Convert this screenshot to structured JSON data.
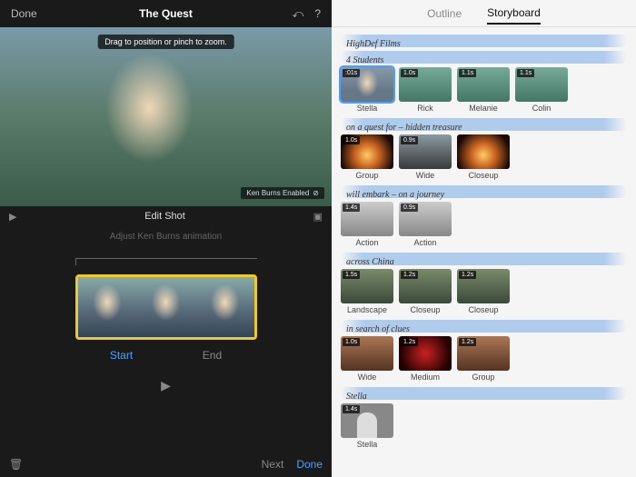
{
  "header": {
    "done": "Done",
    "title": "The Quest"
  },
  "preview": {
    "tip": "Drag to position or pinch to zoom.",
    "kb_badge": "Ken Burns Enabled"
  },
  "editshot": {
    "title": "Edit Shot",
    "subtitle": "Adjust Ken Burns animation",
    "start": "Start",
    "end": "End"
  },
  "footer": {
    "next": "Next",
    "done": "Done"
  },
  "tabs": {
    "outline": "Outline",
    "storyboard": "Storyboard"
  },
  "sections": [
    {
      "title": "HighDef Films",
      "clips": []
    },
    {
      "title": "4 Students",
      "clips": [
        {
          "dur": ":01s",
          "label": "Stella",
          "cls": "t-face",
          "selected": true
        },
        {
          "dur": "1.0s",
          "label": "Rick",
          "cls": "t-people"
        },
        {
          "dur": "1.1s",
          "label": "Melanie",
          "cls": "t-people"
        },
        {
          "dur": "1.1s",
          "label": "Colin",
          "cls": "t-people"
        }
      ]
    },
    {
      "title": "on a quest for – hidden treasure",
      "clips": [
        {
          "dur": "1.0s",
          "label": "Group",
          "cls": "t-fire"
        },
        {
          "dur": "0.9s",
          "label": "Wide",
          "cls": "t-wide"
        },
        {
          "dur": "",
          "label": "Closeup",
          "cls": "t-fire"
        }
      ]
    },
    {
      "title": "will embark – on a journey",
      "clips": [
        {
          "dur": "1.4s",
          "label": "Action",
          "cls": "t-build"
        },
        {
          "dur": "0.9s",
          "label": "Action",
          "cls": "t-build"
        }
      ]
    },
    {
      "title": "across China",
      "clips": [
        {
          "dur": "1.5s",
          "label": "Landscape",
          "cls": "t-china"
        },
        {
          "dur": "1.2s",
          "label": "Closeup",
          "cls": "t-china"
        },
        {
          "dur": "1.2s",
          "label": "Closeup",
          "cls": "t-china"
        }
      ]
    },
    {
      "title": "in search of clues",
      "clips": [
        {
          "dur": "1.0s",
          "label": "Wide",
          "cls": "t-market"
        },
        {
          "dur": "1.2s",
          "label": "Medium",
          "cls": "t-red"
        },
        {
          "dur": "1.2s",
          "label": "Group",
          "cls": "t-market"
        }
      ]
    },
    {
      "title": "Stella",
      "clips": [
        {
          "dur": "1.4s",
          "label": "Stella",
          "cls": "t-placeholder"
        }
      ]
    }
  ]
}
